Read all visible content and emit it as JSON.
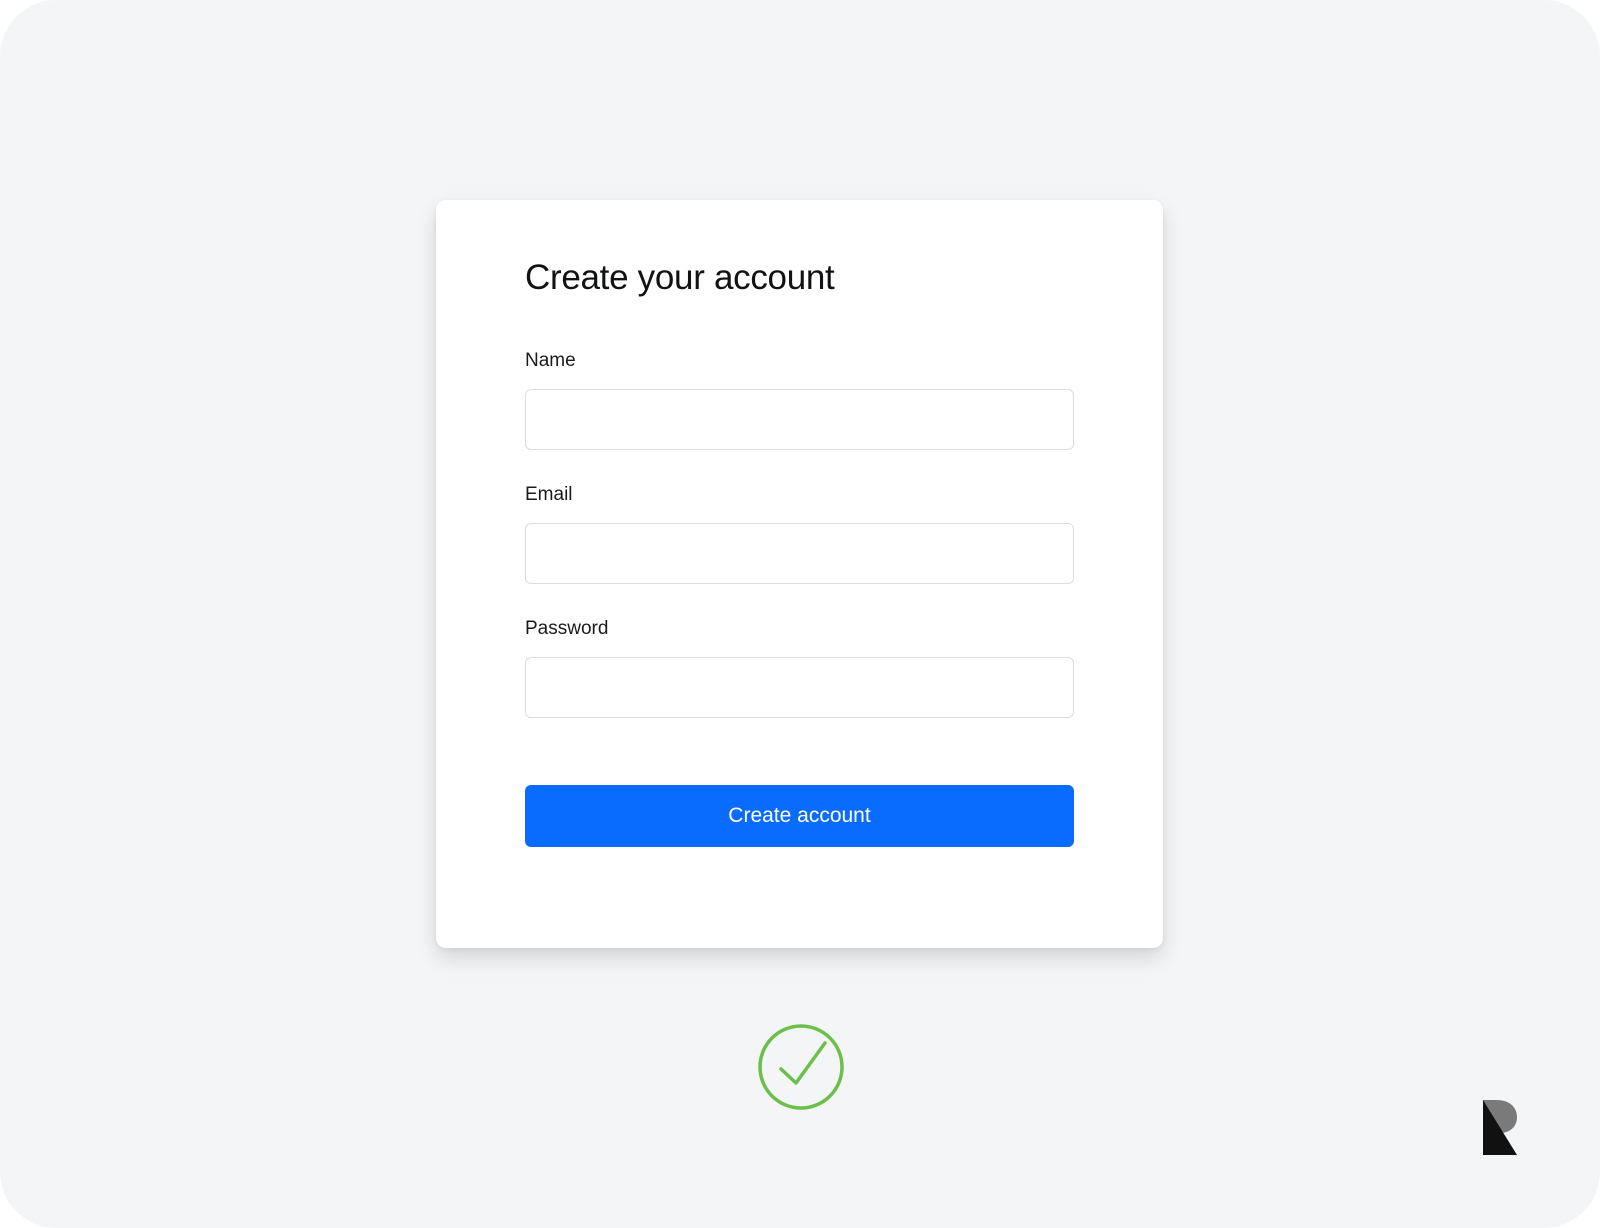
{
  "form": {
    "title": "Create your account",
    "fields": [
      {
        "label": "Name",
        "value": "",
        "placeholder": ""
      },
      {
        "label": "Email",
        "value": "",
        "placeholder": ""
      },
      {
        "label": "Password",
        "value": "",
        "placeholder": ""
      }
    ],
    "submit_label": "Create account"
  },
  "status": {
    "icon": "check-circle-icon",
    "color": "#6cc04a"
  },
  "brand": {
    "icon": "brand-logo-icon"
  },
  "colors": {
    "accent": "#0a6cff",
    "background": "#f4f5f7",
    "card": "#ffffff"
  }
}
